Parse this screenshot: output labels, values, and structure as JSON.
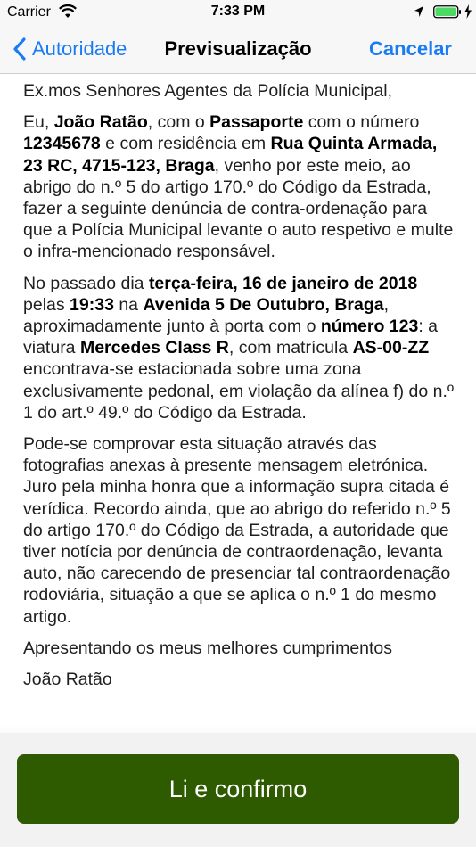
{
  "status_bar": {
    "carrier": "Carrier",
    "time": "7:33 PM"
  },
  "nav": {
    "back_label": "Autoridade",
    "title": "Previsualização",
    "cancel_label": "Cancelar"
  },
  "letter": {
    "greeting": "Ex.mos Senhores Agentes da Polícia Municipal,",
    "p1": {
      "t1": "Eu, ",
      "name": "João Ratão",
      "t2": ", com o ",
      "doc_type": "Passaporte",
      "t3": " com o número ",
      "doc_number": "12345678",
      "t4": " e com residência em ",
      "address": "Rua Quinta Armada, 23 RC, 4715-123, Braga",
      "t5": ", venho por este meio, ao abrigo do n.º 5 do artigo 170.º do Código da Estrada, fazer a seguinte denúncia de contra-ordenação para que a Polícia Municipal levante o auto respetivo e multe o infra-mencionado responsável."
    },
    "p2": {
      "t1": "No passado dia ",
      "date": "terça-feira, 16 de janeiro de 2018",
      "t2": " pelas ",
      "time": "19:33",
      "t3": " na ",
      "place": "Avenida 5 De Outubro, Braga",
      "t4": ", aproximadamente junto à porta com o ",
      "door": "número 123",
      "t5": ": a viatura ",
      "vehicle": "Mercedes Class R",
      "t6": ", com matrícula ",
      "plate": "AS-00-ZZ",
      "t7": " encontrava-se estacionada sobre uma zona exclusivamente pedonal, em violação da alínea f) do n.º 1 do art.º 49.º do Código da Estrada."
    },
    "p3": "Pode-se comprovar esta situação através das fotografias anexas à presente mensagem eletrónica. Juro pela minha honra que a informação supra citada é verídica. Recordo ainda, que ao abrigo do referido n.º 5 do artigo 170.º do Código da Estrada, a autoridade que tiver notícia por denúncia de contraordenação, levanta auto, não carecendo de presenciar tal contraordenação rodoviária, situação a que se aplica o n.º 1 do mesmo artigo.",
    "closing": "Apresentando os meus melhores cumprimentos",
    "signature": "João Ratão"
  },
  "confirm_label": "Li e confirmo",
  "colors": {
    "accent": "#1a7cf5",
    "confirm_button": "#2e5a00",
    "battery": "#4cd964"
  }
}
